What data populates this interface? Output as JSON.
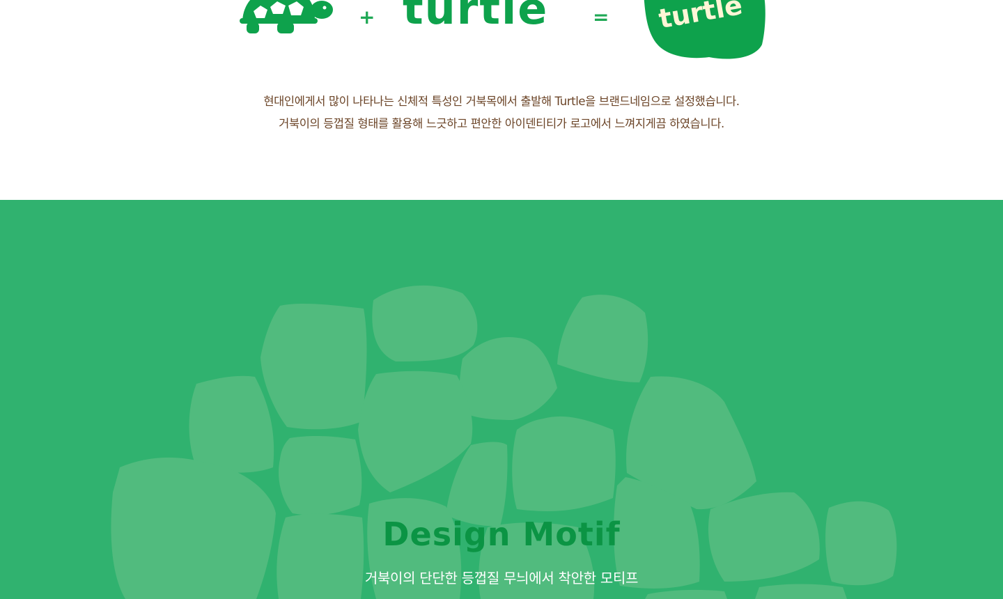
{
  "equation": {
    "plus": "+",
    "wordmark": "turtle",
    "equals": "=",
    "logo_text": "turtle"
  },
  "intro": {
    "line1": "현대인에게서 많이 나타나는 신체적 특성인 거북목에서 출발해 Turtle을 브랜드네임으로 설정했습니다.",
    "line2": "거북이의 등껍질 형태를 활용해 느긋하고 편안한 아이덴티티가 로고에서 느껴지게끔 하였습니다."
  },
  "motif": {
    "title": "Design Motif",
    "subtitle": "거북이의 단단한 등껍질 무늬에서 착안한 모티프"
  },
  "colors": {
    "brand_green": "#0ea24c",
    "motif_background": "#30b26f",
    "shell_plate": "#51bb7e",
    "text_brown": "#6b4427"
  },
  "icons": {
    "turtle": "turtle-icon",
    "logo": "turtle-logo-badge"
  }
}
